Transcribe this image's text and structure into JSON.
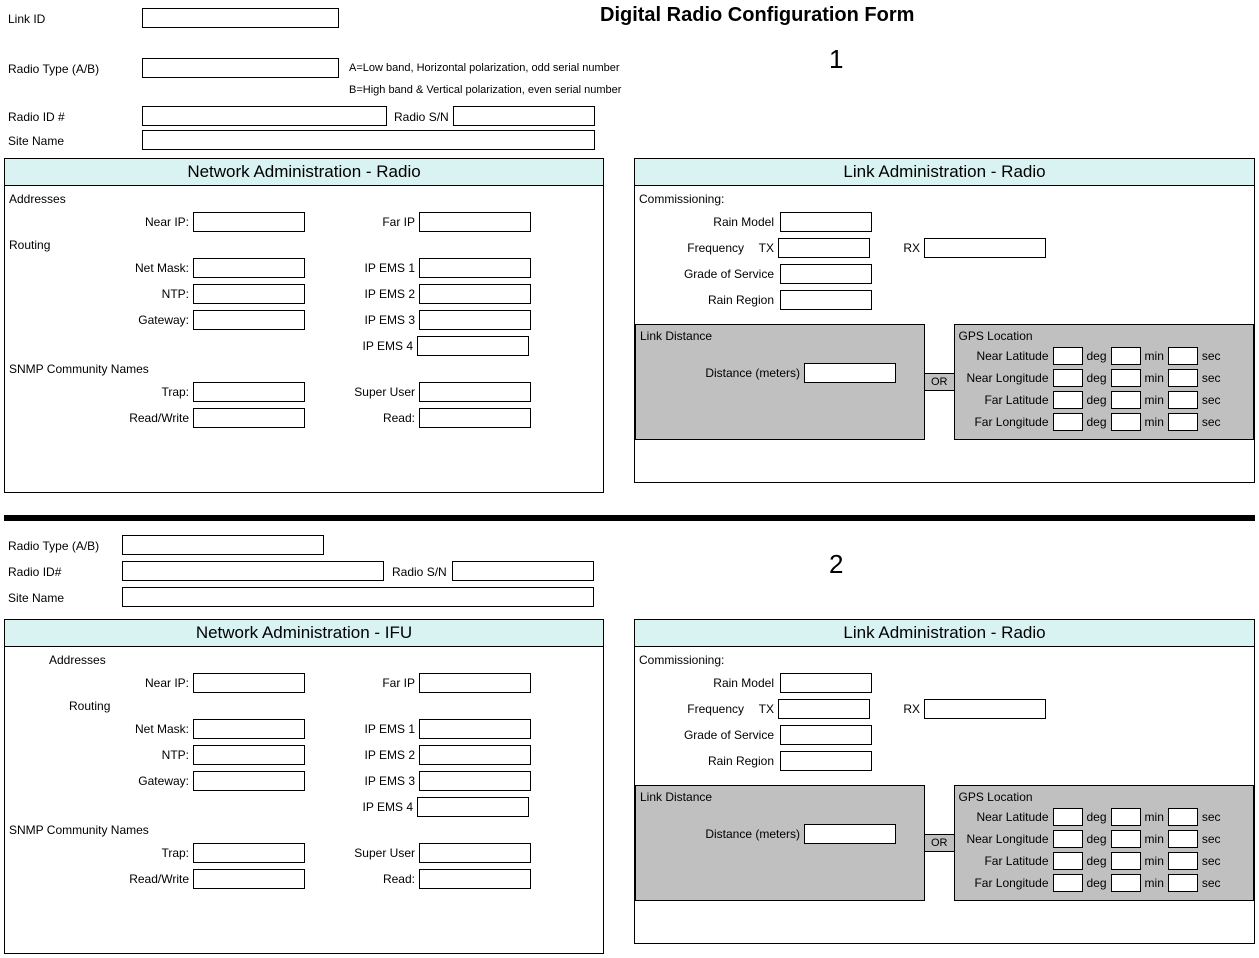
{
  "title": "Digital Radio Configuration Form",
  "num1": "1",
  "num2": "2",
  "labels": {
    "link_id": "Link ID",
    "radio_type": "Radio Type (A/B)",
    "radio_id": "Radio ID #",
    "radio_id2": "Radio ID#",
    "radio_sn": "Radio S/N",
    "site_name": "Site Name",
    "a_note": "A=Low band, Horizontal polarization, odd serial number",
    "b_note": "B=High band & Vertical polarization, even serial number",
    "netadmin_radio": "Network Administration - Radio",
    "netadmin_ifu": "Network Administration - IFU",
    "linkadmin": "Link Administration - Radio",
    "addresses": "Addresses",
    "routing": "Routing",
    "near_ip": "Near IP:",
    "far_ip": "Far IP",
    "net_mask": "Net Mask:",
    "ntp": "NTP:",
    "gateway": "Gateway:",
    "ipems1": "IP EMS 1",
    "ipems2": "IP EMS 2",
    "ipems3": "IP EMS 3",
    "ipems4": "IP EMS 4",
    "snmp": "SNMP Community Names",
    "trap": "Trap:",
    "readwrite": "Read/Write",
    "superuser": "Super User",
    "read": "Read:",
    "commissioning": "Commissioning:",
    "rain_model": "Rain Model",
    "frequency": "Frequency",
    "tx": "TX",
    "rx": "RX",
    "grade": "Grade of Service",
    "rain_region": "Rain Region",
    "link_distance": "Link Distance",
    "distance_m": "Distance (meters)",
    "gps": "GPS Location",
    "near_lat": "Near Latitude",
    "near_lon": "Near Longitude",
    "far_lat": "Far Latitude",
    "far_lon": "Far Longitude",
    "deg": "deg",
    "min": "min",
    "sec": "sec",
    "or": "OR"
  }
}
